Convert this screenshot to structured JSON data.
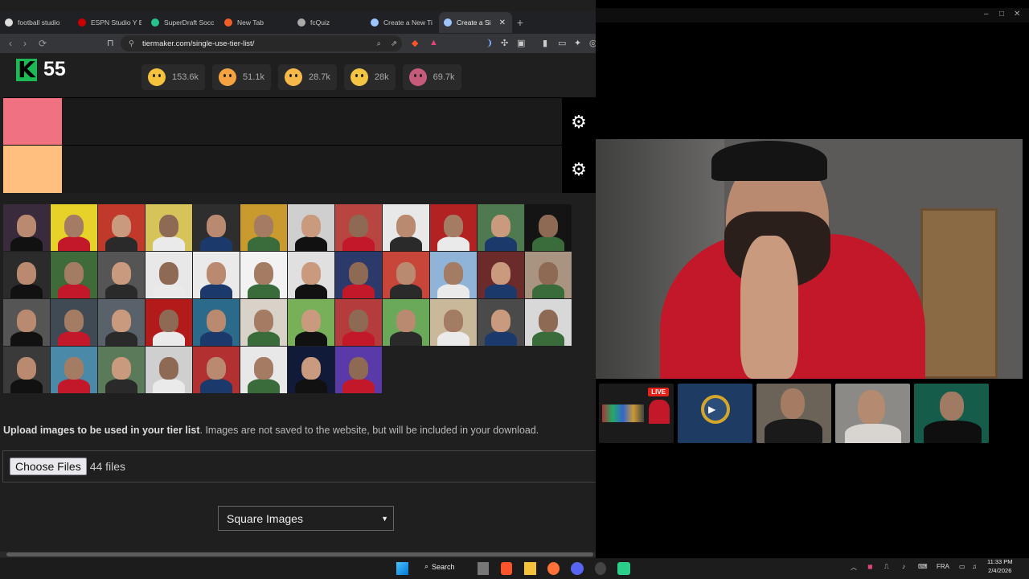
{
  "browser": {
    "tabs": [
      {
        "label": "football studio",
        "color": "#dddddd"
      },
      {
        "label": "ESPN Studio Y B",
        "color": "#cc0000"
      },
      {
        "label": "SuperDraft Socc",
        "color": "#27c38f"
      },
      {
        "label": "New Tab",
        "color": "#f25e27"
      },
      {
        "label": "fcQuiz",
        "color": "#aaaaaa"
      },
      {
        "label": "Create a New Ti",
        "color": "#9ec5ff"
      },
      {
        "label": "Create a Si",
        "color": "#9ec5ff"
      }
    ],
    "url": "tiermaker.com/single-use-tier-list/"
  },
  "page": {
    "points": "55",
    "reactions": [
      {
        "count": "153.6k",
        "icon": "smile-emoji-icon",
        "color": "#f6c23e"
      },
      {
        "count": "51.1k",
        "icon": "heart-eyes-emoji-icon",
        "color": "#f4a340"
      },
      {
        "count": "28.7k",
        "icon": "laugh-emoji-icon",
        "color": "#f7b84b"
      },
      {
        "count": "28k",
        "icon": "clap-emoji-icon",
        "color": "#f4c542"
      },
      {
        "count": "69.7k",
        "icon": "poop-emoji-icon",
        "color": "#c65a7a"
      }
    ],
    "tiers": [
      {
        "color": "#f07280"
      },
      {
        "color": "#ffbf7f"
      }
    ],
    "upload_bold": "Upload images to be used in your tier list",
    "upload_rest": ". Images are not saved to the website, but will be included in your download.",
    "choose_files": "Choose Files",
    "file_count": "44 files",
    "select_value": "Square Images"
  },
  "stream": {
    "live_badge": "LIVE"
  },
  "taskbar": {
    "search": "Search",
    "lang": "FRA",
    "time": "11:33 PM",
    "date": "2/4/2026"
  }
}
